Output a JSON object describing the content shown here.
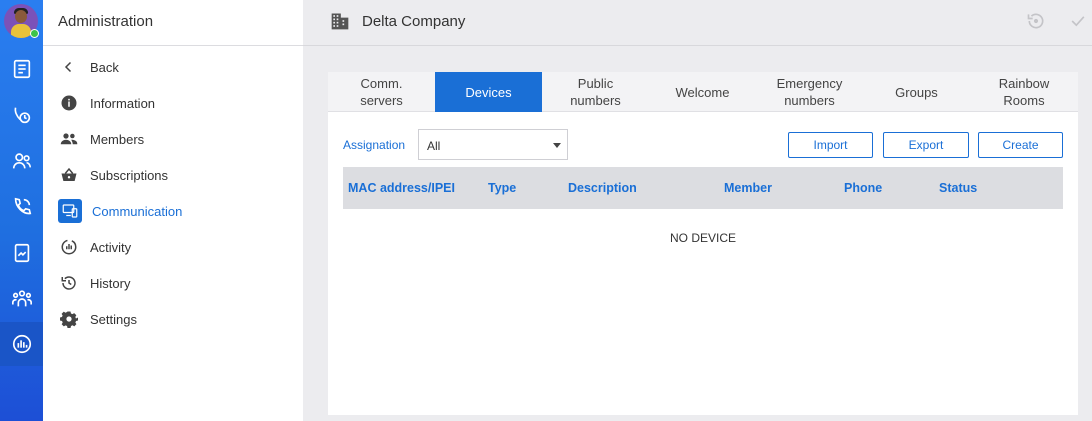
{
  "sidebar": {
    "title": "Administration",
    "items": [
      {
        "label": "Back",
        "icon": "chevron-left-icon"
      },
      {
        "label": "Information",
        "icon": "info-icon"
      },
      {
        "label": "Members",
        "icon": "members-icon"
      },
      {
        "label": "Subscriptions",
        "icon": "basket-icon"
      },
      {
        "label": "Communication",
        "icon": "communication-icon",
        "active": true
      },
      {
        "label": "Activity",
        "icon": "activity-icon"
      },
      {
        "label": "History",
        "icon": "history-icon"
      },
      {
        "label": "Settings",
        "icon": "gear-icon"
      }
    ]
  },
  "header": {
    "company": "Delta Company"
  },
  "tabs": [
    {
      "label": "Comm.\nservers"
    },
    {
      "label": "Devices",
      "active": true
    },
    {
      "label": "Public\nnumbers"
    },
    {
      "label": "Welcome"
    },
    {
      "label": "Emergency\nnumbers"
    },
    {
      "label": "Groups"
    },
    {
      "label": "Rainbow\nRooms"
    }
  ],
  "filter": {
    "label": "Assignation",
    "value": "All"
  },
  "actions": {
    "import": "Import",
    "export": "Export",
    "create": "Create"
  },
  "table": {
    "columns": [
      "MAC address/IPEI",
      "Type",
      "Description",
      "Member",
      "Phone",
      "Status"
    ],
    "empty_text": "NO DEVICE"
  },
  "colors": {
    "accent": "#1a6fd6",
    "rail": "#2a7ef0"
  }
}
